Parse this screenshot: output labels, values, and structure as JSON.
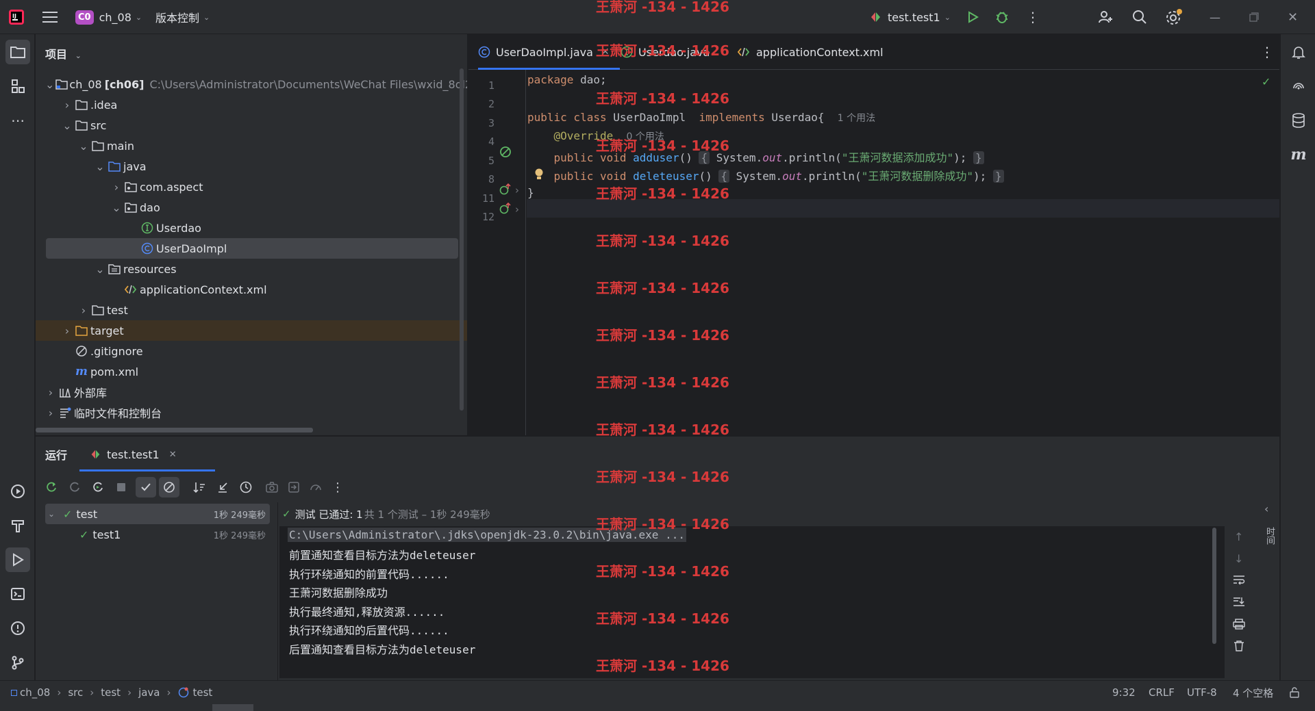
{
  "titlebar": {
    "project_badge": "C0",
    "project_name": "ch_08",
    "vcs_label": "版本控制",
    "run_config": "test.test1"
  },
  "project_panel": {
    "title": "项目",
    "root": {
      "name": "ch_08",
      "module": "[ch06]",
      "path": "C:\\Users\\Administrator\\Documents\\WeChat Files\\wxid_8ol2gsy1"
    },
    "items": [
      {
        "label": ".idea"
      },
      {
        "label": "src"
      },
      {
        "label": "main"
      },
      {
        "label": "java"
      },
      {
        "label": "com.aspect"
      },
      {
        "label": "dao"
      },
      {
        "label": "Userdao"
      },
      {
        "label": "UserDaoImpl"
      },
      {
        "label": "resources"
      },
      {
        "label": "applicationContext.xml"
      },
      {
        "label": "test"
      },
      {
        "label": "target"
      },
      {
        "label": ".gitignore"
      },
      {
        "label": "pom.xml"
      },
      {
        "label": "外部库"
      },
      {
        "label": "临时文件和控制台"
      }
    ]
  },
  "editor": {
    "tabs": [
      {
        "label": "UserDaoImpl.java"
      },
      {
        "label": "Userdao.java"
      },
      {
        "label": "applicationContext.xml"
      }
    ],
    "line_numbers": [
      "1",
      "2",
      "3",
      "4",
      "5",
      "8",
      "11",
      "12"
    ],
    "lines": {
      "l1_kw": "package",
      "l1_rest": " dao;",
      "l3_kw": "public class",
      "l3_name": " UserDaoImpl  ",
      "l3_kw2": "implements",
      "l3_rest": " Userdao{",
      "l3_usage": "1 个用法",
      "l4_ann": "@Override",
      "l4_usage": "0 个用法",
      "l5_kw": "public void",
      "l5_fn": "adduser",
      "l5_paren": "()",
      "l5_sys": "System.",
      "l5_out": "out",
      "l5_call": ".println(",
      "l5_str": "\"王萧河数据添加成功\"",
      "l5_end": ");",
      "l8_kw": "public void",
      "l8_fn": "deleteuser",
      "l8_paren": "()",
      "l8_sys": "System.",
      "l8_out": "out",
      "l8_call": ".println(",
      "l8_str": "\"王萧河数据删除成功\"",
      "l8_end": ");",
      "l11": "}"
    }
  },
  "run_panel": {
    "title": "运行",
    "tab_label": "test.test1",
    "tests": [
      {
        "name": "test",
        "time": "1秒 249毫秒"
      },
      {
        "name": "test1",
        "time": "1秒 249毫秒"
      }
    ],
    "summary_passed": "测试 已通过: 1",
    "summary_detail": "共 1 个测试 – 1秒 249毫秒",
    "console_lines": [
      "C:\\Users\\Administrator\\.jdks\\openjdk-23.0.2\\bin\\java.exe ...",
      "前置通知查看目标方法为deleteuser",
      "执行环绕通知的前置代码......",
      "王萧河数据删除成功",
      "执行最终通知,释放资源......",
      "执行环绕通知的后置代码......",
      "后置通知查看目标方法为deleteuser"
    ],
    "side_label": "时间"
  },
  "statusbar": {
    "breadcrumb": [
      "ch_08",
      "src",
      "test",
      "java",
      "test"
    ],
    "position": "9:32",
    "line_ending": "CRLF",
    "encoding": "UTF-8",
    "indent": "4 个空格"
  },
  "watermark": "王萧河 -134 - 1426",
  "colors": {
    "accent": "#3574f0",
    "success": "#5fb865",
    "watermark": "#d93a3a",
    "bg_editor": "#1e1f22",
    "bg_panel": "#2b2d30"
  }
}
